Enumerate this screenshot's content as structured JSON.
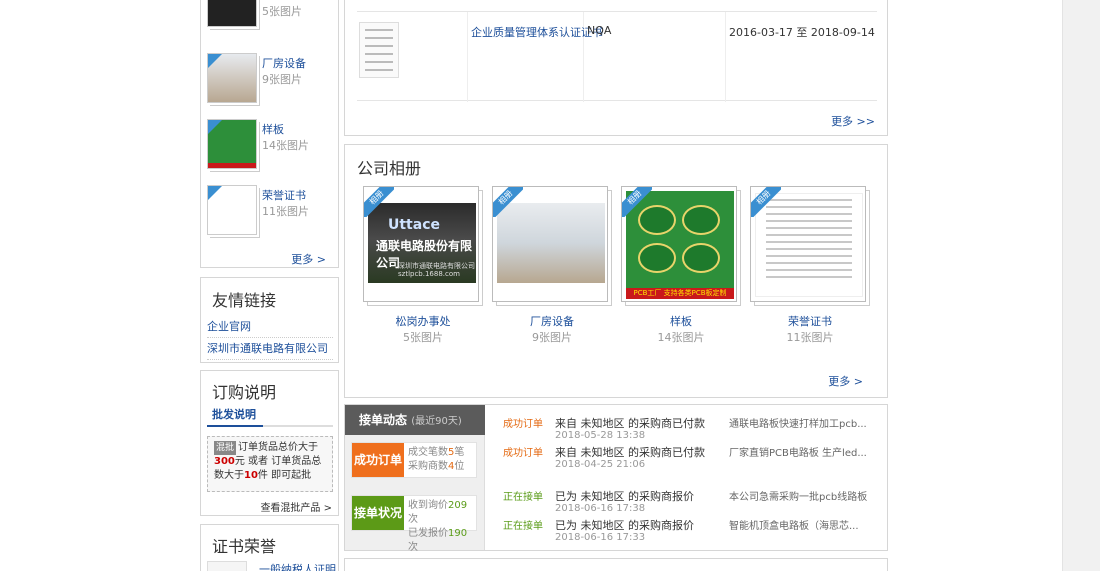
{
  "left_albums": {
    "items": [
      {
        "title": "",
        "count": "5张图片"
      },
      {
        "title": "厂房设备",
        "count": "9张图片"
      },
      {
        "title": "样板",
        "count": "14张图片"
      },
      {
        "title": "荣誉证书",
        "count": "11张图片"
      }
    ],
    "more": "更多 >"
  },
  "friend_links": {
    "title": "友情链接",
    "links": [
      "企业官网",
      "深圳市通联电路有限公司"
    ]
  },
  "order_info": {
    "title": "订购说明",
    "tab": "批发说明",
    "tag": "混批",
    "line1": "订单货品总价大于",
    "amount": "300",
    "line2": "元  或者 订单货品总",
    "line3": "数大于",
    "qty": "10",
    "line4": "件  即可起批",
    "link": "查看混批产品 >"
  },
  "cert_side": {
    "title": "证书荣誉",
    "item": "一般纳税人证明材"
  },
  "cert_table": {
    "name": "企业质量管理体系认证证书",
    "org": "NQA",
    "date": "2016-03-17 至 2018-09-14",
    "more": "更多 >>"
  },
  "albums": {
    "title": "公司相册",
    "ribbon": "相册",
    "items": [
      {
        "title": "松岗办事处",
        "count": "5张图片",
        "logo": "Uttace",
        "company": "通联电路股份有限公司",
        "addr": "深圳市通联电路有限公司",
        "site": "sztlpcb.1688.com"
      },
      {
        "title": "厂房设备",
        "count": "9张图片"
      },
      {
        "title": "样板",
        "count": "14张图片",
        "banner": "PCB工厂 支持各类PCB板定制"
      },
      {
        "title": "荣誉证书",
        "count": "11张图片"
      }
    ],
    "more": "更多 >"
  },
  "order_dynamics": {
    "title": "接单动态",
    "subtitle": "(最近90天)",
    "success_label": "成功订单",
    "success_deals": "成交笔数",
    "success_deals_n": "5",
    "success_deals_unit": "笔",
    "buyers": "采购商数",
    "buyers_n": "4",
    "buyers_unit": "位",
    "status_label": "接单状况",
    "inquiries": "收到询价",
    "inquiries_n": "209",
    "inquiries_unit": "次",
    "quotes": "已发报价",
    "quotes_n": "190",
    "quotes_unit": "次",
    "rows": [
      {
        "status": "成功订单",
        "desc": "来自 未知地区 的采购商已付款",
        "time": "2018-05-28 13:38",
        "product": "通联电路板快速打样加工pcb..."
      },
      {
        "status": "成功订单",
        "desc": "来自 未知地区 的采购商已付款",
        "time": "2018-04-25 21:06",
        "product": "厂家直销PCB电路板 生产led..."
      },
      {
        "status": "正在接单",
        "desc": "已为 未知地区 的采购商报价",
        "time": "2018-06-16 17:38",
        "product": "本公司急需采购一批pcb线路板"
      },
      {
        "status": "正在接单",
        "desc": "已为 未知地区 的采购商报价",
        "time": "2018-06-16 17:33",
        "product": "智能机顶盒电路板（海思芯..."
      }
    ]
  },
  "colors": {
    "link": "#1d4f9a",
    "success": "#e46a13",
    "active": "#5b9c1a",
    "ribbon": "#3a8fd1"
  }
}
